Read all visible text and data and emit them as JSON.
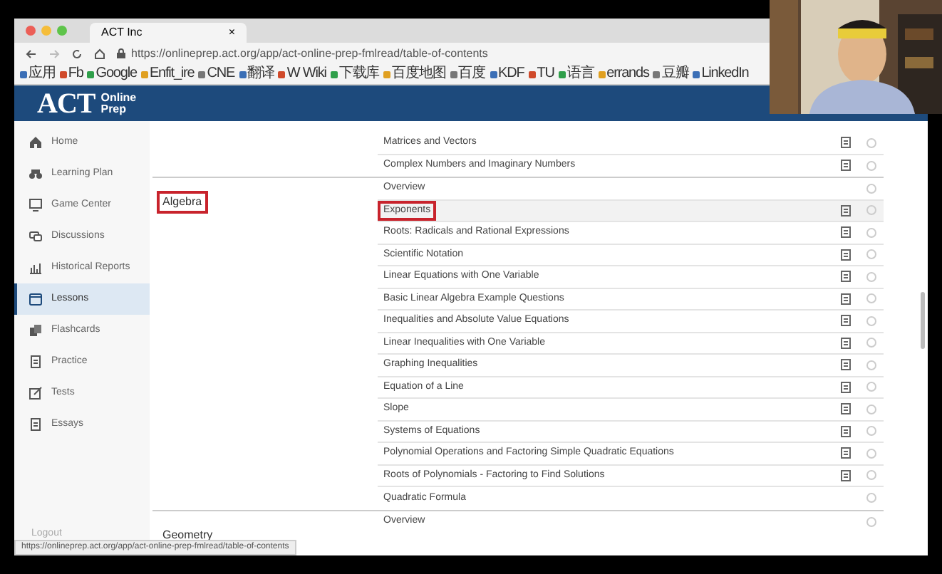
{
  "browser": {
    "tab_title": "ACT Inc",
    "tab_close": "×",
    "url": "https://onlineprep.act.org/app/act-online-prep-fmlread/table-of-contents",
    "bookmarks": [
      "应用",
      "Fb",
      "Google",
      "Enfit_ire",
      "CNE",
      "翻译",
      "W Wiki",
      "下载库",
      "百度地图",
      "百度",
      "KDF",
      "TU",
      "语言",
      "errands",
      "豆瓣",
      "LinkedIn"
    ]
  },
  "header": {
    "logo": "ACT",
    "logo_sub": [
      "Online",
      "Prep"
    ]
  },
  "sidebar": {
    "items": [
      {
        "label": "Home",
        "selected": false
      },
      {
        "label": "Learning Plan",
        "selected": false
      },
      {
        "label": "Game Center",
        "selected": false
      },
      {
        "label": "Discussions",
        "selected": false
      },
      {
        "label": "Historical Reports",
        "selected": false
      },
      {
        "label": "Lessons",
        "selected": true
      },
      {
        "label": "Flashcards",
        "selected": false
      },
      {
        "label": "Practice",
        "selected": false
      },
      {
        "label": "Tests",
        "selected": false
      },
      {
        "label": "Essays",
        "selected": false
      }
    ],
    "logout": "Logout"
  },
  "sections": [
    {
      "topics": [
        {
          "title": "Matrices and Vectors",
          "has_doc": true,
          "highlighted": false
        },
        {
          "title": "Complex Numbers and Imaginary Numbers",
          "has_doc": true,
          "highlighted": false
        }
      ]
    },
    {
      "title": "Algebra",
      "highlighted": true,
      "topics": [
        {
          "title": "Overview",
          "has_doc": false,
          "highlighted": false
        },
        {
          "title": "Exponents",
          "has_doc": true,
          "highlighted": true
        },
        {
          "title": "Roots: Radicals and Rational Expressions",
          "has_doc": true,
          "highlighted": false
        },
        {
          "title": "Scientific Notation",
          "has_doc": true,
          "highlighted": false
        },
        {
          "title": "Linear Equations with One Variable",
          "has_doc": true,
          "highlighted": false
        },
        {
          "title": "Basic Linear Algebra Example Questions",
          "has_doc": true,
          "highlighted": false
        },
        {
          "title": "Inequalities and Absolute Value Equations",
          "has_doc": true,
          "highlighted": false
        },
        {
          "title": "Linear Inequalities with One Variable",
          "has_doc": true,
          "highlighted": false
        },
        {
          "title": "Graphing Inequalities",
          "has_doc": true,
          "highlighted": false
        },
        {
          "title": "Equation of a Line",
          "has_doc": true,
          "highlighted": false
        },
        {
          "title": "Slope",
          "has_doc": true,
          "highlighted": false
        },
        {
          "title": "Systems of Equations",
          "has_doc": true,
          "highlighted": false
        },
        {
          "title": "Polynomial Operations and Factoring Simple Quadratic Equations",
          "has_doc": true,
          "highlighted": false
        },
        {
          "title": "Roots of Polynomials - Factoring to Find Solutions",
          "has_doc": true,
          "highlighted": false
        },
        {
          "title": "Quadratic Formula",
          "has_doc": false,
          "highlighted": false
        }
      ]
    },
    {
      "title": "Geometry",
      "highlighted": false,
      "topics": [
        {
          "title": "Overview",
          "has_doc": false,
          "highlighted": false
        }
      ]
    }
  ],
  "status_bar": "https://onlineprep.act.org/app/act-online-prep-fmlread/table-of-contents"
}
